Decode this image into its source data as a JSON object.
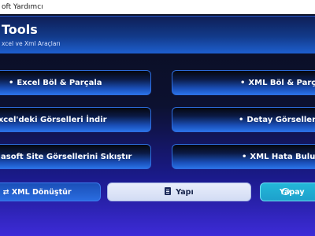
{
  "window": {
    "title": "oft Yardımcı"
  },
  "header": {
    "title": "Tools",
    "subtitle": "xcel ve Xml Araçları"
  },
  "buttons": {
    "excel_split": "Excel Böl & Parçala",
    "xml_split": "XML Böl & Parça",
    "excel_images": "Excel'deki Görselleri İndir",
    "detail_images": "Detay Görsellerini İn",
    "compress_site_images": "asoft Site Görsellerini Sıkıştır",
    "xml_error_finder": "XML Hata Bulucu",
    "convert": "l ⇄ XML Dönüştür",
    "yapi": "Yapı",
    "yapay": "Yapay"
  },
  "bullet": "•",
  "colors": {
    "accent_blue": "#2a72e6",
    "header_blue": "#1e5fcf",
    "cyan": "#23b8d8",
    "purple_bottom": "#3d2bd8"
  },
  "icons": {
    "yapi": "document-icon",
    "yapay": "chat-bubble-icon"
  }
}
